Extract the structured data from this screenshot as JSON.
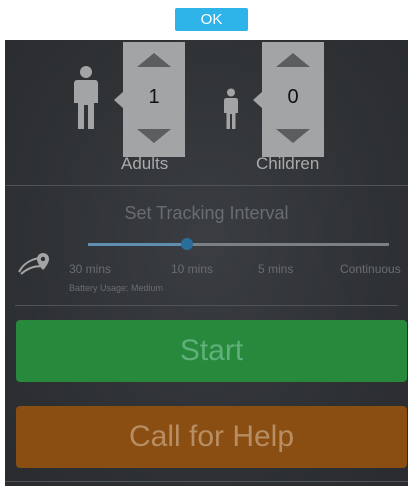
{
  "ok_label": "OK",
  "counters": [
    {
      "label": "Adults",
      "value": "1"
    },
    {
      "label": "Children",
      "value": "0"
    }
  ],
  "tracking": {
    "title": "Set Tracking Interval",
    "options": [
      "30 mins",
      "10 mins",
      "5 mins",
      "Continuous"
    ],
    "selected": "10 mins",
    "battery_text": "Battery Usage: Medium"
  },
  "actions": {
    "start_label": "Start",
    "help_label": "Call for Help"
  },
  "colors": {
    "ok": "#2fb4ea",
    "start": "#27893c",
    "help": "#8a4d12",
    "panel": "#303336"
  }
}
